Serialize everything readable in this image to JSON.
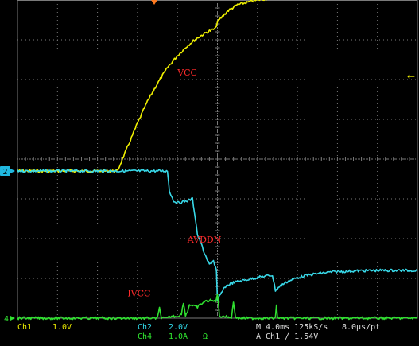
{
  "colors": {
    "background": "#000000",
    "grid": "#7a7a7a",
    "ch1": "#f0f000",
    "ch2": "#38d8e8",
    "ch4": "#30e030",
    "annotation": "#ff2a2a",
    "marker_orange": "#ff7a20",
    "marker_cyan": "#20b8e0"
  },
  "chart_data": {
    "type": "line",
    "title": "",
    "xlabel": "",
    "ylabel": "",
    "grid": true,
    "x_unit": "ms",
    "xlim": [
      0,
      40
    ],
    "ylim": [
      0,
      8
    ],
    "series": [
      {
        "name": "VCC",
        "channel": "Ch1",
        "color": "#f0f000",
        "x": [
          0,
          10.0,
          11.0,
          12.0,
          13.0,
          14.0,
          15.0,
          16.0,
          17.0,
          18.0,
          19.0,
          19.8,
          20.0,
          21.0,
          22.0,
          24.0,
          26.0,
          28.0,
          30.0,
          34.0,
          38.0,
          40.0
        ],
        "y": [
          3.7,
          3.7,
          4.3,
          4.9,
          5.45,
          5.9,
          6.3,
          6.6,
          6.85,
          7.05,
          7.2,
          7.28,
          7.45,
          7.72,
          7.88,
          8.0,
          8.07,
          8.12,
          8.15,
          8.18,
          8.2,
          8.2
        ]
      },
      {
        "name": "AVDDN",
        "channel": "Ch2",
        "color": "#38d8e8",
        "x": [
          0,
          15.0,
          15.2,
          15.6,
          16.0,
          17.0,
          17.5,
          17.8,
          18.0,
          18.4,
          18.8,
          19.2,
          19.6,
          19.9,
          20.0,
          20.2,
          20.8,
          21.4,
          22.0,
          22.6,
          23.5,
          24.6,
          25.5,
          25.8,
          26.0,
          26.5,
          27.0,
          27.5,
          28.0,
          29.0,
          30.0,
          31.0,
          32.0,
          33.0,
          34.0,
          36.0,
          38.0,
          40.0
        ],
        "y": [
          3.7,
          3.7,
          3.2,
          2.95,
          2.9,
          2.95,
          3.0,
          2.5,
          2.1,
          1.85,
          1.55,
          1.35,
          1.45,
          1.2,
          0.42,
          0.55,
          0.8,
          0.88,
          0.92,
          0.95,
          1.0,
          1.05,
          1.08,
          0.7,
          0.75,
          0.85,
          0.92,
          0.97,
          1.02,
          1.08,
          1.12,
          1.15,
          1.17,
          1.18,
          1.19,
          1.2,
          1.2,
          1.2
        ]
      },
      {
        "name": "IVCC",
        "channel": "Ch4",
        "color": "#30e030",
        "x": [
          0,
          14.0,
          14.2,
          14.4,
          14.6,
          15.0,
          15.4,
          16.0,
          16.4,
          16.6,
          16.8,
          17.0,
          17.2,
          17.6,
          18.0,
          18.6,
          19.2,
          19.8,
          20.0,
          20.2,
          20.6,
          21.0,
          21.4,
          21.6,
          21.8,
          22.0,
          24.0,
          25.8,
          25.9,
          26.0,
          26.2,
          28.0,
          32.0,
          36.0,
          40.0
        ],
        "y": [
          0,
          0,
          0.25,
          0.02,
          0,
          0,
          0.05,
          0.05,
          0.1,
          0.4,
          0.08,
          0.15,
          0.35,
          0.3,
          0.28,
          0.4,
          0.45,
          0.42,
          0.6,
          0.05,
          0.05,
          0.03,
          0.02,
          0.4,
          0.05,
          0,
          0,
          0,
          0.35,
          0.03,
          0,
          0,
          0,
          0,
          0
        ]
      }
    ],
    "annotations": [
      {
        "text": "VCC",
        "x": 16.0,
        "y": 6.1
      },
      {
        "text": "AVDDN",
        "x": 17.0,
        "y": 1.9
      },
      {
        "text": "IVCC",
        "x": 11.0,
        "y": 0.55
      }
    ],
    "markers": {
      "ch2_label": "2",
      "ch4_label": "4",
      "trigger_arrow": "←"
    }
  },
  "status": {
    "ch1": "Ch1",
    "ch1_scale": "1.0V",
    "ch2": "Ch2",
    "ch2_scale": "2.0V",
    "ch4": "Ch4",
    "ch4_scale": "1.0A",
    "ch4_unit_symbol": "Ω",
    "timebase": "M 4.0ms 125kS/s",
    "sample_period": "8.0µs/pt",
    "trigger": "A Ch1 ∕ 1.54V"
  }
}
